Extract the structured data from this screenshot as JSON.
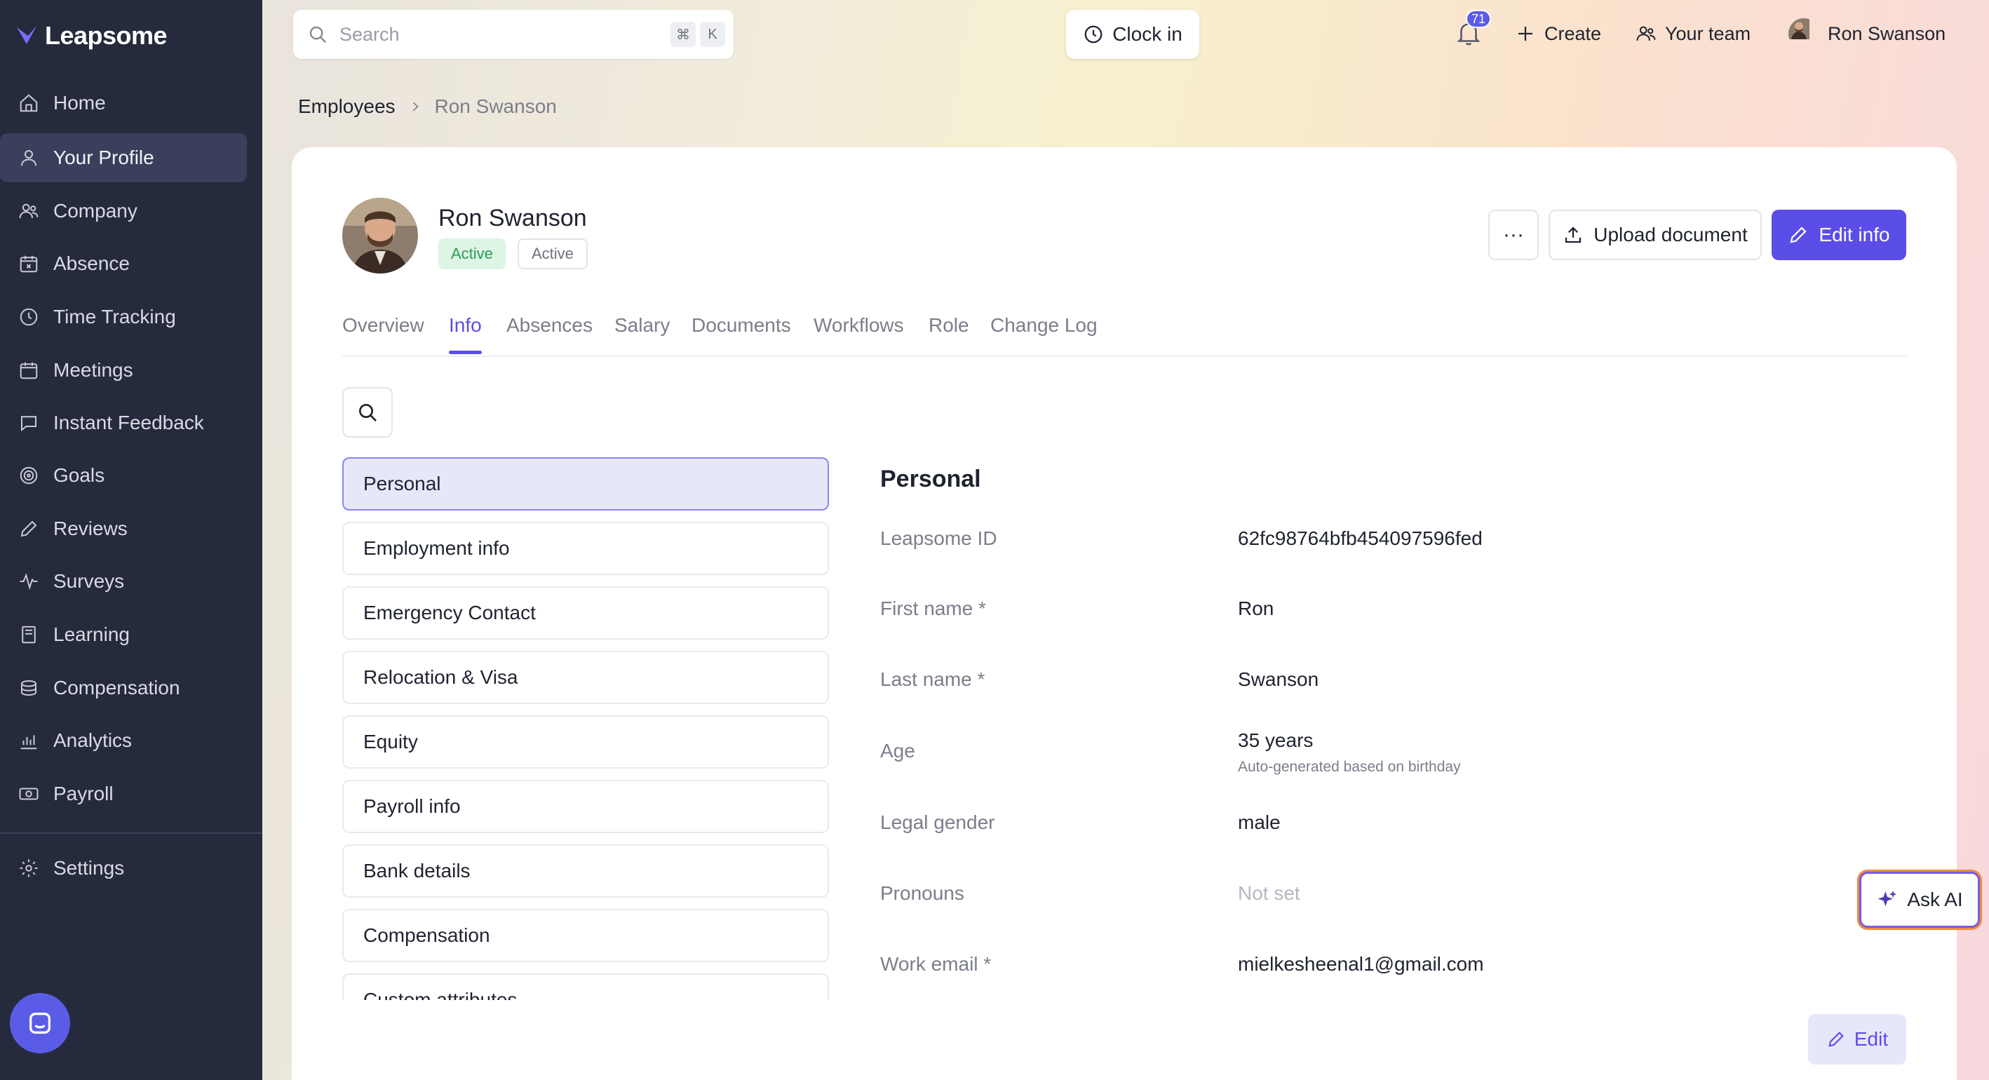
{
  "app": {
    "name": "Leapsome"
  },
  "colors": {
    "accent": "#5b4de8",
    "sidebar_bg": "#262a3d",
    "success": "#2e9a57"
  },
  "sidebar": {
    "items": [
      {
        "label": "Home",
        "icon": "home-icon"
      },
      {
        "label": "Your Profile",
        "icon": "user-icon",
        "active": true
      },
      {
        "label": "Company",
        "icon": "people-icon"
      },
      {
        "label": "Absence",
        "icon": "calendar-x-icon"
      },
      {
        "label": "Time Tracking",
        "icon": "clock-icon"
      },
      {
        "label": "Meetings",
        "icon": "calendar-icon"
      },
      {
        "label": "Instant Feedback",
        "icon": "chat-icon"
      },
      {
        "label": "Goals",
        "icon": "target-icon"
      },
      {
        "label": "Reviews",
        "icon": "pencil-icon"
      },
      {
        "label": "Surveys",
        "icon": "pulse-icon"
      },
      {
        "label": "Learning",
        "icon": "book-icon"
      },
      {
        "label": "Compensation",
        "icon": "coins-icon"
      },
      {
        "label": "Analytics",
        "icon": "chart-icon"
      },
      {
        "label": "Payroll",
        "icon": "money-icon"
      }
    ],
    "settings": {
      "label": "Settings",
      "icon": "gear-icon"
    }
  },
  "topbar": {
    "search_placeholder": "Search",
    "shortcut_keys": [
      "⌘",
      "K"
    ],
    "clock_in": "Clock in",
    "notifications_count": "71",
    "create": "Create",
    "your_team": "Your team",
    "user_name": "Ron Swanson"
  },
  "breadcrumb": {
    "parent": "Employees",
    "current": "Ron Swanson"
  },
  "profile": {
    "name": "Ron Swanson",
    "status_badge": "Active",
    "status_badge_2": "Active",
    "more": "···",
    "upload_document": "Upload document",
    "edit_info": "Edit info"
  },
  "tabs": [
    "Overview",
    "Info",
    "Absences",
    "Salary",
    "Documents",
    "Workflows",
    "Role",
    "Change Log"
  ],
  "active_tab": "Info",
  "sections": [
    "Personal",
    "Employment info",
    "Emergency Contact",
    "Relocation & Visa",
    "Equity",
    "Payroll info",
    "Bank details",
    "Compensation",
    "Custom attributes"
  ],
  "details": {
    "title": "Personal",
    "fields": [
      {
        "label": "Leapsome ID",
        "value": "62fc98764bfb454097596fed"
      },
      {
        "label": "First name *",
        "value": "Ron"
      },
      {
        "label": "Last name *",
        "value": "Swanson"
      },
      {
        "label": "Age",
        "value": "35 years",
        "sub": "Auto-generated based on birthday"
      },
      {
        "label": "Legal gender",
        "value": "male"
      },
      {
        "label": "Pronouns",
        "value": "Not set"
      },
      {
        "label": "Work email *",
        "value": "mielkesheenal1@gmail.com"
      }
    ]
  },
  "ask_ai": "Ask AI",
  "edit": "Edit"
}
